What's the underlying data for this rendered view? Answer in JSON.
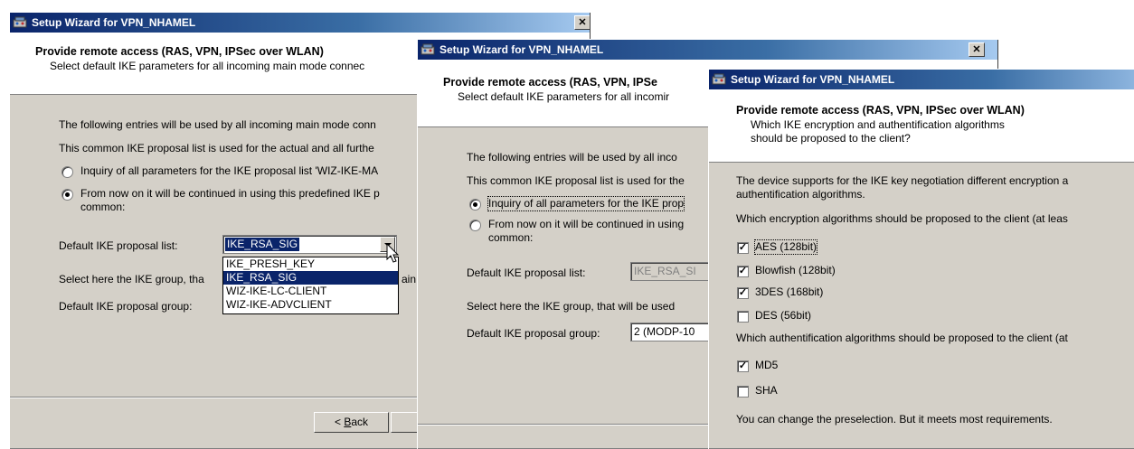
{
  "window1": {
    "title": "Setup Wizard for VPN_NHAMEL",
    "header_title": "Provide remote access (RAS, VPN, IPSec over WLAN)",
    "header_subtitle": "Select default IKE parameters for all incoming main mode connec",
    "intro_line1": "The following entries will be used by all incoming main mode conn",
    "intro_line2": "This common IKE proposal list is used for the actual and all furthe",
    "radio_inquiry": "Inquiry of all parameters for the IKE proposal list 'WIZ-IKE-MA",
    "radio_predefined_line1": "From now on it will be continued in using this predefined IKE p",
    "radio_predefined_line2": "common:",
    "proposal_list_label": "Default IKE proposal list:",
    "proposal_list_value": "IKE_RSA_SIG",
    "dropdown_options": [
      "IKE_PRESH_KEY",
      "IKE_RSA_SIG",
      "WIZ-IKE-LC-CLIENT",
      "WIZ-IKE-ADVCLIENT"
    ],
    "dropdown_selected": "IKE_RSA_SIG",
    "group_help_line": "Select here the IKE group, tha",
    "group_help_tail": "ain",
    "proposal_group_label": "Default IKE proposal group:",
    "back_button_prefix": "< ",
    "back_button_mnemonic": "B",
    "back_button_rest": "ack"
  },
  "window2": {
    "title": "Setup Wizard for VPN_NHAMEL",
    "header_title": "Provide remote access (RAS, VPN, IPSe",
    "header_subtitle": "Select default IKE parameters for all incomir",
    "intro_line1": "The following entries will be used by all inco",
    "intro_line2": "This common IKE proposal list is used for the",
    "radio_inquiry": "Inquiry of all parameters for the IKE prop",
    "radio_predefined_line1": "From now on it will be continued in using",
    "radio_predefined_line2": "common:",
    "proposal_list_label": "Default IKE proposal list:",
    "proposal_list_value": "IKE_RSA_SI",
    "group_help_line": "Select here the IKE group, that will be used",
    "proposal_group_label": "Default IKE proposal group:",
    "proposal_group_value": "2 (MODP-10"
  },
  "window3": {
    "title": "Setup Wizard for VPN_NHAMEL",
    "header_title": "Provide remote access (RAS, VPN, IPSec over WLAN)",
    "header_subtitle_line1": "Which IKE encryption and authentification algorithms",
    "header_subtitle_line2": "should be proposed to the client?",
    "intro_line1": "The device supports for the IKE key negotiation different encryption a",
    "intro_line2": "authentification algorithms.",
    "encryption_question": "Which encryption algorithms should be proposed to the client (at leas",
    "encryption_options": [
      {
        "label": "AES (128bit)",
        "checked": true
      },
      {
        "label": "Blowfish (128bit)",
        "checked": true
      },
      {
        "label": "3DES (168bit)",
        "checked": true
      },
      {
        "label": "DES (56bit)",
        "checked": false
      }
    ],
    "auth_question": "Which authentification algorithms should be proposed to the client (at",
    "auth_options": [
      {
        "label": "MD5",
        "checked": true
      },
      {
        "label": "SHA",
        "checked": false
      }
    ],
    "footer_note": "You can change the preselection. But it meets most requirements."
  },
  "colors": {
    "titlebar_start": "#0a246a",
    "titlebar_end": "#a6caf0",
    "dialog_face": "#d4d0c8",
    "selection": "#0a246a"
  },
  "icons": {
    "app": "network-wizard-icon",
    "close": "close-icon",
    "mouse": "mouse-cursor-icon"
  }
}
